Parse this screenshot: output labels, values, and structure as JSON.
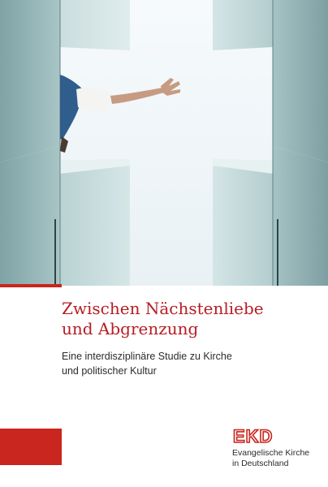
{
  "cover": {
    "title_line1": "Zwischen Nächstenliebe",
    "title_line2": "und Abgrenzung",
    "subtitle_line1": "Eine interdisziplinäre Studie zu Kirche",
    "subtitle_line2": "und politischer Kultur",
    "accent_color": "#c8261e"
  },
  "publisher": {
    "logo_text": "EKD",
    "name_line1": "Evangelische Kirche",
    "name_line2": "in Deutschland"
  }
}
